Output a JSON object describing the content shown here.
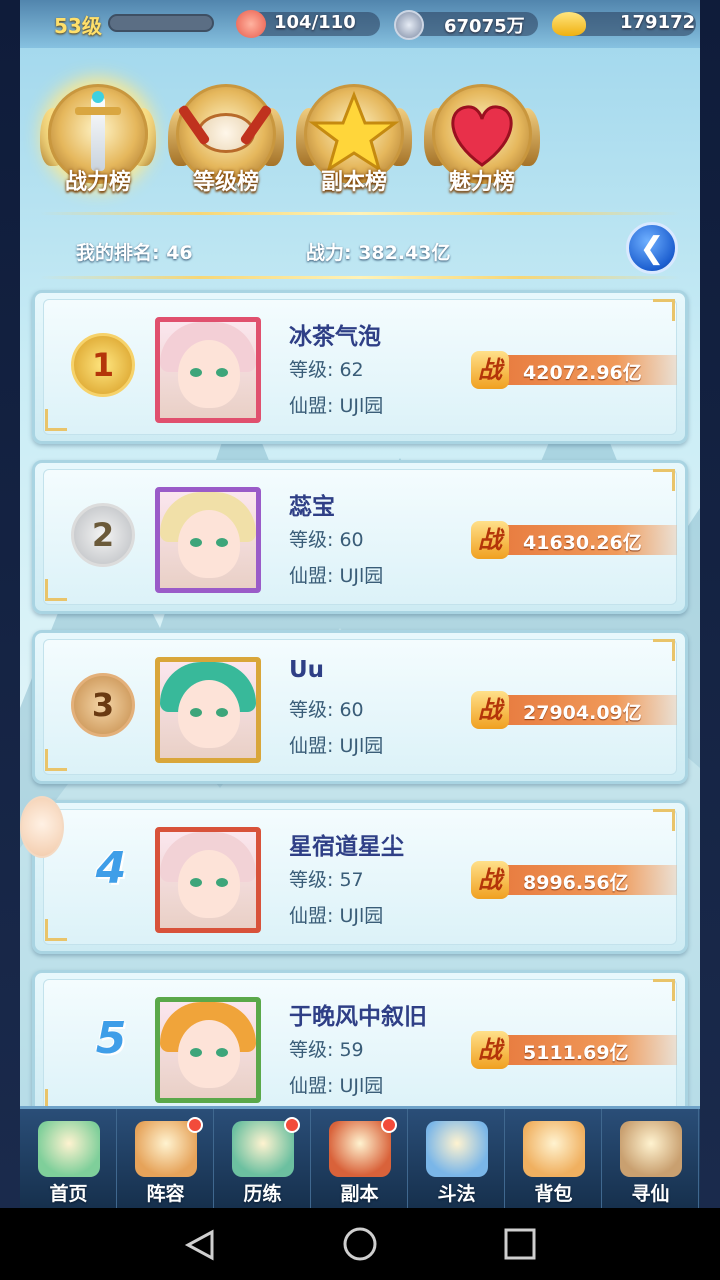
{
  "status": {
    "level": "53级",
    "stamina": "104/110",
    "silver": "67075万",
    "gold": "179172"
  },
  "tabs": [
    {
      "label": "战力榜",
      "active": true,
      "icon": "sword-medal-icon"
    },
    {
      "label": "等级榜",
      "active": false,
      "icon": "drum-medal-icon"
    },
    {
      "label": "副本榜",
      "active": false,
      "icon": "star-medal-icon"
    },
    {
      "label": "魅力榜",
      "active": false,
      "icon": "heart-medal-icon"
    }
  ],
  "my_rank": {
    "rank_text": "我的排名: 46",
    "power_text": "战力: 382.43亿"
  },
  "rankings": [
    {
      "rank": "1",
      "name": "冰茶气泡",
      "level": "等级: 62",
      "guild": "仙盟: UJl园",
      "power": "42072.96亿",
      "frame_color": "#e0506e",
      "hair_color": "#f3cfd6"
    },
    {
      "rank": "2",
      "name": "蕊宝",
      "level": "等级: 60",
      "guild": "仙盟: UJl园",
      "power": "41630.26亿",
      "frame_color": "#9a5bc8",
      "hair_color": "#f1e0a8"
    },
    {
      "rank": "3",
      "name": "Uu",
      "level": "等级: 60",
      "guild": "仙盟: UJl园",
      "power": "27904.09亿",
      "frame_color": "#d9a63a",
      "hair_color": "#38b99a"
    },
    {
      "rank": "4",
      "name": "星宿道星尘",
      "level": "等级: 57",
      "guild": "仙盟: UJl园",
      "power": "8996.56亿",
      "frame_color": "#d8523a",
      "hair_color": "#f2d2d6"
    },
    {
      "rank": "5",
      "name": "于晚风中叙旧",
      "level": "等级: 59",
      "guild": "仙盟: UJl园",
      "power": "5111.69亿",
      "frame_color": "#5aa84a",
      "hair_color": "#f0a43a"
    }
  ],
  "power_badge": "战",
  "nav": [
    {
      "label": "首页",
      "dot": false
    },
    {
      "label": "阵容",
      "dot": true
    },
    {
      "label": "历练",
      "dot": true
    },
    {
      "label": "副本",
      "dot": true
    },
    {
      "label": "斗法",
      "dot": false
    },
    {
      "label": "背包",
      "dot": false
    },
    {
      "label": "寻仙",
      "dot": false
    }
  ]
}
